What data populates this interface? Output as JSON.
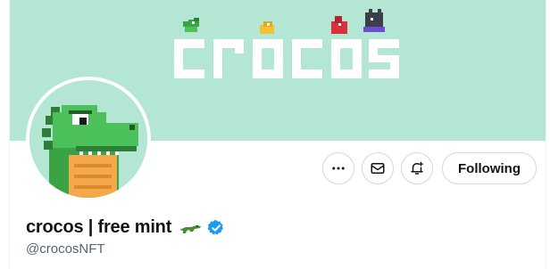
{
  "profile": {
    "display_name": "crocos | free mint",
    "handle": "@crocosNFT",
    "verified": true
  },
  "banner": {
    "logo_text": "crocos",
    "background_color": "#b3e6d3"
  },
  "actions": {
    "more_icon": "more-horizontal-icon",
    "message_icon": "envelope-icon",
    "notify_icon": "bell-plus-icon",
    "follow_label": "Following"
  },
  "colors": {
    "accent_verified": "#1d9bf0",
    "text_primary": "#0f1419",
    "text_secondary": "#536471",
    "border": "#cfd9de"
  }
}
